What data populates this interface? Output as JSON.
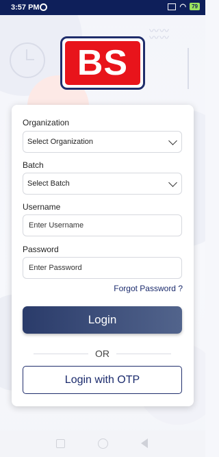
{
  "status": {
    "time": "3:57 PM",
    "battery": "79"
  },
  "logo": {
    "text": "BS"
  },
  "form": {
    "organization_label": "Organization",
    "organization_value": "Select Organization",
    "batch_label": "Batch",
    "batch_value": "Select Batch",
    "username_label": "Username",
    "username_placeholder": "Enter Username",
    "password_label": "Password",
    "password_placeholder": "Enter Password",
    "forgot_password": "Forgot Password ?",
    "login_button": "Login",
    "or_text": "OR",
    "otp_button": "Login with OTP"
  },
  "colors": {
    "status_bar": "#0e1f5a",
    "logo_red": "#e8141b",
    "logo_border": "#1f2d6b",
    "login_gradient_start": "#2a3b6a",
    "login_gradient_end": "#52648c",
    "link": "#1a2a6c"
  },
  "icons": {
    "dropdown": "chevron-down-icon",
    "sync": "sync-icon",
    "wifi": "wifi-icon",
    "nav_recent": "square-icon",
    "nav_home": "circle-icon",
    "nav_back": "back-triangle-icon"
  }
}
